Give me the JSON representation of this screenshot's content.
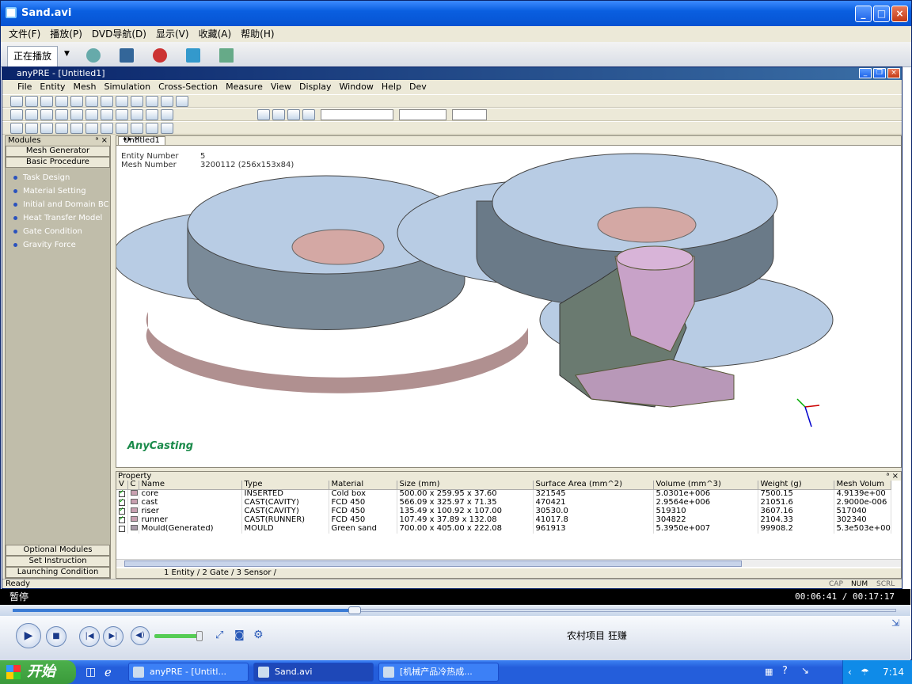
{
  "wmp": {
    "title": "Sand.avi",
    "menu": [
      "文件(F)",
      "播放(P)",
      "DVD导航(D)",
      "显示(V)",
      "收藏(A)",
      "帮助(H)"
    ],
    "tab_now_playing": "正在播放",
    "state": "暂停",
    "time": "00:06:41 / 00:17:17",
    "progress": 0.387,
    "volume": 0.9,
    "track_info": "农村项目 狂赚"
  },
  "anyfre": {
    "title": "anyPRE - [Untitled1]",
    "menu": [
      "File",
      "Entity",
      "Mesh",
      "Simulation",
      "Cross-Section",
      "Measure",
      "View",
      "Display",
      "Window",
      "Help",
      "Dev"
    ],
    "modules_header": "Modules",
    "module_buttons": [
      "Mesh Generator",
      "Basic Procedure"
    ],
    "module_items": [
      "Task Design",
      "Material Setting",
      "Initial and Domain BC",
      "Heat Transfer Model",
      "Gate Condition",
      "Gravity Force"
    ],
    "bottom_buttons": [
      "Optional Modules",
      "Set Instruction",
      "Launching Condition"
    ],
    "view_tab": "Untitled1",
    "info": [
      {
        "k": "Entity Number",
        "v": "5"
      },
      {
        "k": "Mesh Number",
        "v": "3200112 (256x153x84)"
      }
    ],
    "logo": "AnyCasting",
    "property_header": "Property",
    "columns": [
      "V",
      "C",
      "Name",
      "Type",
      "Material",
      "Size (mm)",
      "Surface Area (mm^2)",
      "Volume (mm^3)",
      "Weight (g)",
      "Mesh Volum"
    ],
    "rows": [
      {
        "v": true,
        "name": "core",
        "type": "INSERTED",
        "material": "Cold box",
        "size": "500.00 x 259.95 x 37.60",
        "area": "321545",
        "volume": "5.0301e+006",
        "weight": "7500.15",
        "mesh": "4.9139e+00"
      },
      {
        "v": true,
        "name": "cast",
        "type": "CAST(CAVITY)",
        "material": "FCD 450",
        "size": "566.09 x 325.97 x 71.35",
        "area": "470421",
        "volume": "2.9564e+006",
        "weight": "21051.6",
        "mesh": "2.9000e-006"
      },
      {
        "v": true,
        "name": "riser",
        "type": "CAST(CAVITY)",
        "material": "FCD 450",
        "size": "135.49 x 100.92 x 107.00",
        "area": "30530.0",
        "volume": "519310",
        "weight": "3607.16",
        "mesh": "517040"
      },
      {
        "v": true,
        "name": "runner",
        "type": "CAST(RUNNER)",
        "material": "FCD 450",
        "size": "107.49 x 37.89 x 132.08",
        "area": "41017.8",
        "volume": "304822",
        "weight": "2104.33",
        "mesh": "302340"
      },
      {
        "v": false,
        "name": "Mould(Generated)",
        "type": "MOULD",
        "material": "Green sand",
        "size": "700.00 x 405.00 x 222.08",
        "area": "961913",
        "volume": "5.3950e+007",
        "weight": "99908.2",
        "mesh": "5.3e503e+00"
      }
    ],
    "sheet_tabs": "1 Entity / 2 Gate / 3 Sensor /",
    "status": "Ready",
    "indicators": [
      "CAP",
      "NUM",
      "SCRL"
    ]
  },
  "taskbar": {
    "start": "开始",
    "tasks": [
      "anyPRE - [Untitl...",
      "Sand.avi",
      "[机械产品冷热成..."
    ],
    "clock": "7:14"
  },
  "colors": {
    "xp_blue": "#245edb",
    "part_blue": "#b8cce4",
    "part_pink": "#c8a2c8",
    "part_gray": "#6a7a80"
  }
}
